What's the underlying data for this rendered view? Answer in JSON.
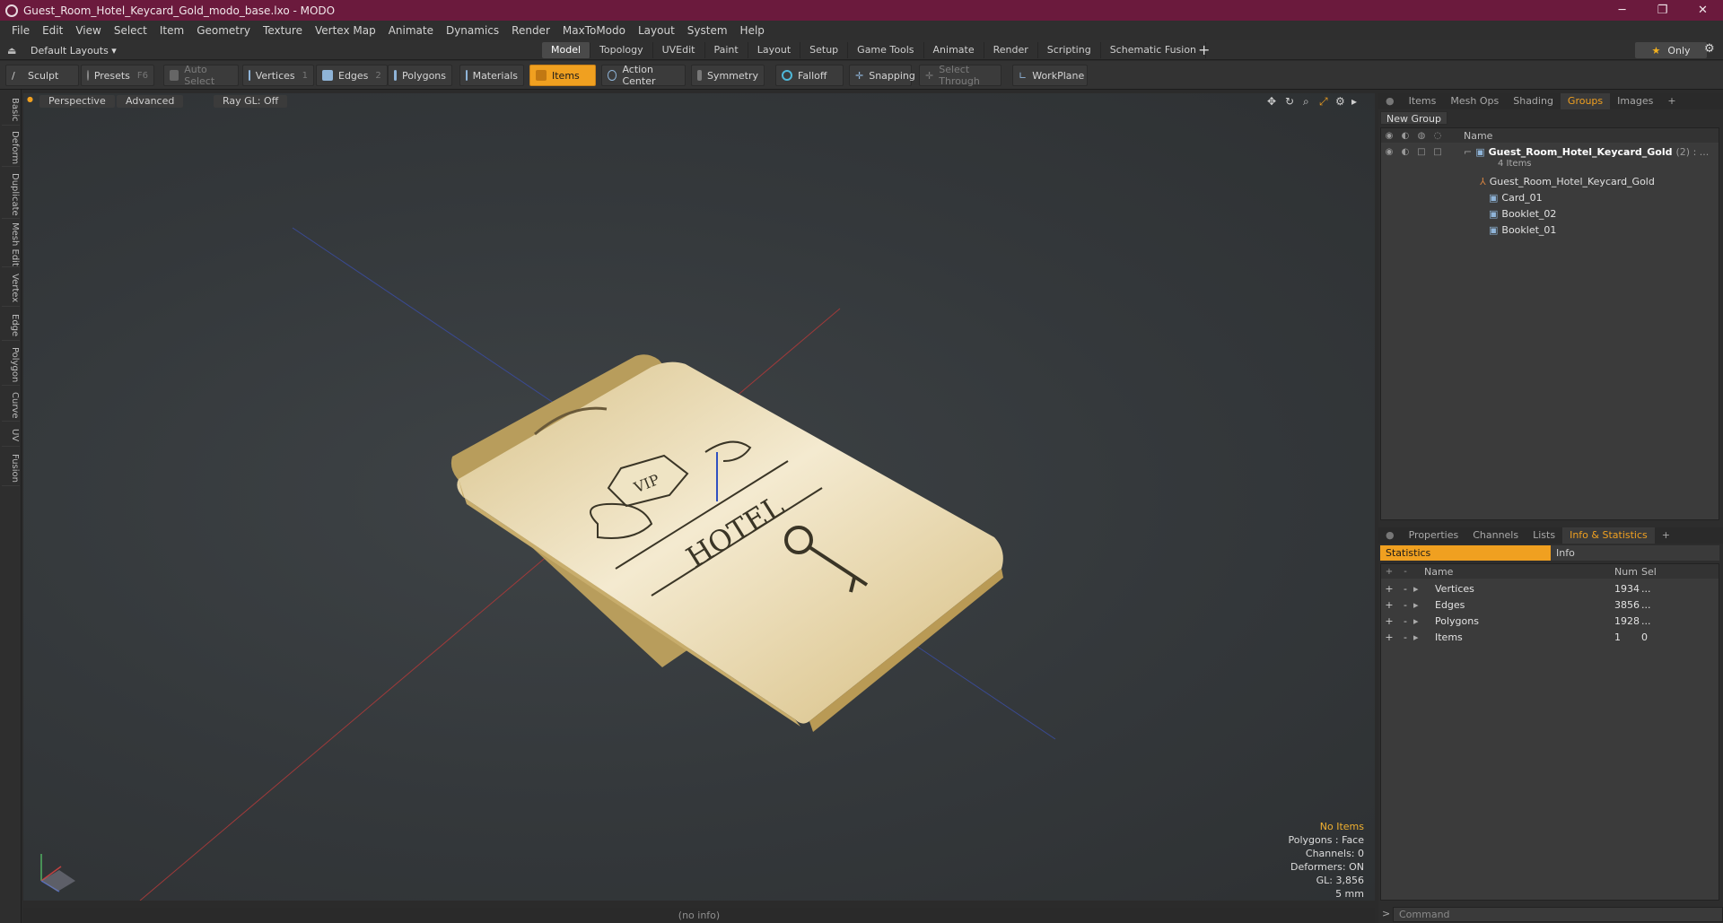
{
  "window": {
    "title": "Guest_Room_Hotel_Keycard_Gold_modo_base.lxo - MODO",
    "minimize": "─",
    "maximize": "❐",
    "close": "✕"
  },
  "menu": [
    "File",
    "Edit",
    "View",
    "Select",
    "Item",
    "Geometry",
    "Texture",
    "Vertex Map",
    "Animate",
    "Dynamics",
    "Render",
    "MaxToModo",
    "Layout",
    "System",
    "Help"
  ],
  "layouts": {
    "label": "Default Layouts ▾"
  },
  "tabs": [
    "Model",
    "Topology",
    "UVEdit",
    "Paint",
    "Layout",
    "Setup",
    "Game Tools",
    "Animate",
    "Render",
    "Scripting",
    "Schematic Fusion"
  ],
  "active_tab": "Model",
  "only": {
    "label": "Only"
  },
  "toolbar": {
    "sculpt": "Sculpt",
    "presets": "Presets",
    "presets_key": "F6",
    "auto_select": "Auto Select",
    "vertices": "Vertices",
    "vertices_num": "1",
    "edges": "Edges",
    "edges_num": "2",
    "polygons": "Polygons",
    "materials": "Materials",
    "items": "Items",
    "action_center": "Action Center",
    "symmetry": "Symmetry",
    "falloff": "Falloff",
    "snapping": "Snapping",
    "select_through": "Select Through",
    "workplane": "WorkPlane"
  },
  "left_tabs": [
    "Basic",
    "Deform",
    "Duplicate",
    "Mesh Edit",
    "Vertex",
    "Edge",
    "Polygon",
    "Curve",
    "UV",
    "Fusion"
  ],
  "viewport": {
    "perspective": "Perspective",
    "advanced": "Advanced",
    "raygl": "Ray GL: Off",
    "hud": [
      "No Items",
      "Polygons : Face",
      "Channels: 0",
      "Deformers: ON",
      "GL: 3,856",
      "5 mm"
    ],
    "card_texts": {
      "vip": "VIP",
      "hotel": "HOTEL"
    }
  },
  "status": "(no info)",
  "groups_panel": {
    "tabs": [
      "Items",
      "Mesh Ops",
      "Shading",
      "Groups",
      "Images"
    ],
    "active": "Groups",
    "new_group": "New Group",
    "col_name": "Name",
    "root": {
      "name": "Guest_Room_Hotel_Keycard_Gold",
      "suffix": "(2) : ...",
      "count": "4 Items"
    },
    "children": [
      "Guest_Room_Hotel_Keycard_Gold",
      "Card_01",
      "Booklet_02",
      "Booklet_01"
    ]
  },
  "stats_panel": {
    "tabs": [
      "Properties",
      "Channels",
      "Lists",
      "Info & Statistics"
    ],
    "active": "Info & Statistics",
    "subtabs": [
      "Statistics",
      "Info"
    ],
    "columns": [
      "Name",
      "Num",
      "Sel"
    ],
    "rows": [
      {
        "name": "Vertices",
        "num": "1934",
        "sel": "..."
      },
      {
        "name": "Edges",
        "num": "3856",
        "sel": "..."
      },
      {
        "name": "Polygons",
        "num": "1928",
        "sel": "..."
      },
      {
        "name": "Items",
        "num": "1",
        "sel": "0"
      }
    ]
  },
  "command": {
    "placeholder": "Command"
  },
  "colors": {
    "title_bar": "#6b1a3d",
    "accent": "#f0a020",
    "card": "#e8d7a0"
  }
}
